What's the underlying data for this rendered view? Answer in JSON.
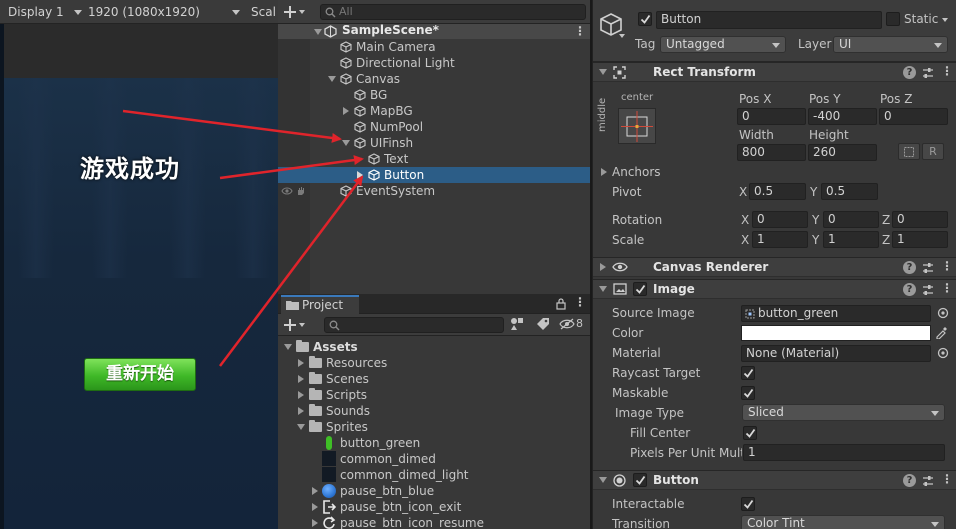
{
  "game": {
    "display": "Display 1",
    "resolution": "1920 (1080x1920)",
    "scale_label": "Scal",
    "win_text": "游戏成功",
    "restart_label": "重新开始"
  },
  "hierarchy": {
    "search_placeholder": "All",
    "scene_name": "SampleScene*",
    "items": [
      {
        "label": "Main Camera"
      },
      {
        "label": "Directional Light"
      },
      {
        "label": "Canvas"
      },
      {
        "label": "BG"
      },
      {
        "label": "MapBG"
      },
      {
        "label": "NumPool"
      },
      {
        "label": "UIFinsh"
      },
      {
        "label": "Text"
      },
      {
        "label": "Button"
      },
      {
        "label": "EventSystem"
      }
    ]
  },
  "project": {
    "tab_label": "Project",
    "hidden_count": "8",
    "assets_label": "Assets",
    "folders": [
      "Resources",
      "Scenes",
      "Scripts",
      "Sounds",
      "Sprites"
    ],
    "sprites": [
      {
        "label": "button_green",
        "icon": "green-bar-icon",
        "color": "#3fbf26"
      },
      {
        "label": "common_dimed",
        "icon": "dark-square-icon",
        "color": "#121a24"
      },
      {
        "label": "common_dimed_light",
        "icon": "dark-square-icon",
        "color": "#121a24"
      },
      {
        "label": "pause_btn_blue",
        "icon": "blue-circle-icon",
        "color": "#2f78d6"
      },
      {
        "label": "pause_btn_icon_exit",
        "icon": "exit-icon",
        "color": "#e8e8e8"
      },
      {
        "label": "pause_btn_icon_resume",
        "icon": "resume-icon",
        "color": "#e8e8e8"
      }
    ]
  },
  "inspector": {
    "object_name": "Button",
    "static_label": "Static",
    "tag_label": "Tag",
    "tag_value": "Untagged",
    "layer_label": "Layer",
    "layer_value": "UI",
    "rect_transform": {
      "title": "Rect Transform",
      "anchor_h": "center",
      "anchor_v": "middle",
      "pos_x_label": "Pos X",
      "pos_y_label": "Pos Y",
      "pos_z_label": "Pos Z",
      "pos_x": "0",
      "pos_y": "-400",
      "pos_z": "0",
      "width_label": "Width",
      "height_label": "Height",
      "width": "800",
      "height": "260",
      "r_button": "R",
      "anchors_label": "Anchors",
      "pivot_label": "Pivot",
      "pivot_x": "0.5",
      "pivot_y": "0.5",
      "rotation_label": "Rotation",
      "rot_x": "0",
      "rot_y": "0",
      "rot_z": "0",
      "scale_label": "Scale",
      "scale_x": "1",
      "scale_y": "1",
      "scale_z": "1",
      "axis_x": "X",
      "axis_y": "Y",
      "axis_z": "Z"
    },
    "canvas_renderer": {
      "title": "Canvas Renderer"
    },
    "image": {
      "title": "Image",
      "source_label": "Source Image",
      "source_value": "button_green",
      "color_label": "Color",
      "color_value": "#ffffff",
      "material_label": "Material",
      "material_value": "None (Material)",
      "raycast_label": "Raycast Target",
      "maskable_label": "Maskable",
      "type_label": "Image Type",
      "type_value": "Sliced",
      "fill_center_label": "Fill Center",
      "ppu_label": "Pixels Per Unit Multi",
      "ppu_value": "1"
    },
    "button": {
      "title": "Button",
      "interactable_label": "Interactable",
      "transition_label": "Transition",
      "transition_value": "Color Tint"
    }
  },
  "colors": {
    "selection": "#2c5d87",
    "annotation_arrow": "#e0242b",
    "button_green": "#3fb827"
  }
}
